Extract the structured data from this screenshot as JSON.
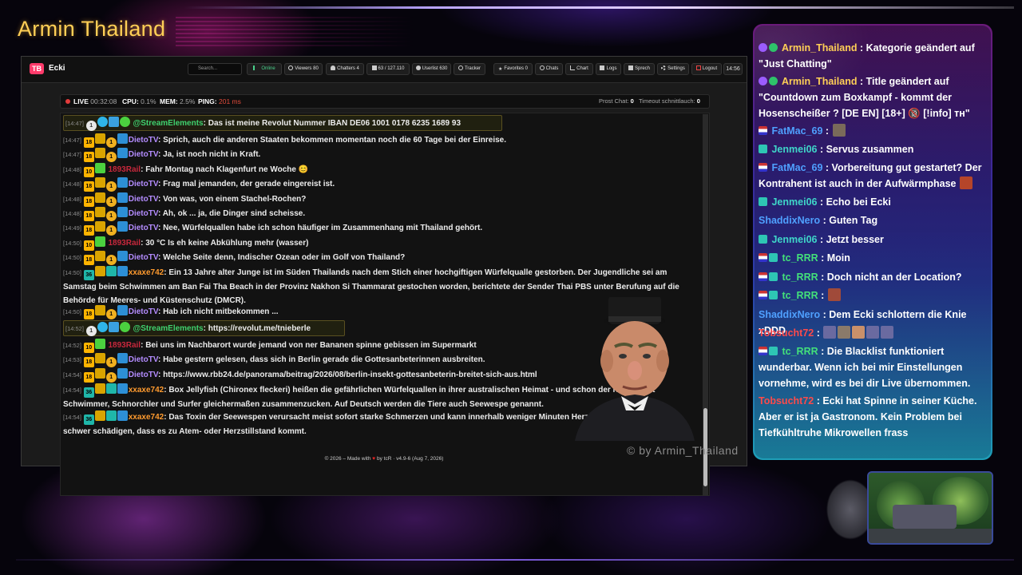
{
  "overlay": {
    "streamer_name": "Armin Thailand",
    "watermark": "© by Armin_Thailand"
  },
  "app": {
    "logo": "TB",
    "name": "Ecki",
    "search_placeholder": "Search...",
    "nav": {
      "online": "Online",
      "viewers": "Viewers 80",
      "chatters": "Chatters 4",
      "points": "63 / 127.110",
      "userlist": "Userlist 630",
      "tracker": "Tracker",
      "favorites": "Favorites 0",
      "chats": "Chats",
      "chart": "Chart",
      "logs": "Logs",
      "sprech": "Sprech",
      "settings": "Settings",
      "logout": "Logout",
      "clock": "14:56"
    },
    "status": {
      "live_label": "LIVE",
      "live_time": "00:32:08",
      "cpu_label": "CPU:",
      "cpu_value": "0.1%",
      "mem_label": "MEM:",
      "mem_value": "2.5%",
      "ping_label": "PING:",
      "ping_value": "201 ms",
      "prost_label": "Prost Chat:",
      "prost_value": "0",
      "timeout_label": "Timeout schnittlauch:",
      "timeout_value": "0"
    },
    "footer_pre": "© 2026 – Made with",
    "footer_post": "by tcR · v4.9-6 (Aug 7, 2026)"
  },
  "chat": [
    {
      "ts": "[14:47]",
      "user": "@StreamElements",
      "text": "Das ist meine Revolut Nummer IBAN DE06 1001 0178 6235 1689 93"
    },
    {
      "ts": "[14:47]",
      "user": "DietoTV",
      "text": "Sprich, auch die anderen Staaten bekommen momentan noch die 60 Tage bei der Einreise."
    },
    {
      "ts": "[14:47]",
      "user": "DietoTV",
      "text": "Ja, ist noch nicht in Kraft."
    },
    {
      "ts": "[14:48]",
      "user": "1893Rail",
      "text": "Fahr Montag nach Klagenfurt ne Woche 😊"
    },
    {
      "ts": "[14:48]",
      "user": "DietoTV",
      "text": "Frag mal jemanden, der gerade eingereist ist."
    },
    {
      "ts": "[14:48]",
      "user": "DietoTV",
      "text": "Von was, von einem Stachel-Rochen?"
    },
    {
      "ts": "[14:48]",
      "user": "DietoTV",
      "text": "Ah, ok ... ja, die Dinger sind scheisse."
    },
    {
      "ts": "[14:49]",
      "user": "DietoTV",
      "text": "Nee, Würfelquallen habe ich schon häufiger im Zusammenhang mit Thailand gehört."
    },
    {
      "ts": "[14:50]",
      "user": "1893Rail",
      "text": "30 °C Is eh keine Abkühlung mehr (wasser)"
    },
    {
      "ts": "[14:50]",
      "user": "DietoTV",
      "text": "Welche Seite denn, Indischer Ozean oder im Golf von Thailand?"
    },
    {
      "ts": "[14:50]",
      "user": "xxaxe742",
      "text": "Ein 13 Jahre alter Junge ist im Süden Thailands nach dem Stich einer hochgiftigen Würfelqualle gestorben. Der Jugendliche sei am Samstag beim Schwimmen am Ban Fai Tha Beach in der Provinz Nakhon Si Thammarat gestochen worden, berichtete der Sender Thai PBS unter Berufung auf die Behörde für Meeres- und Küstenschutz (DMCR)."
    },
    {
      "ts": "[14:50]",
      "user": "DietoTV",
      "text": "Hab ich nicht mitbekommen ..."
    },
    {
      "ts": "[14:52]",
      "user": "@StreamElements",
      "text": "https://revolut.me/tnieberle"
    },
    {
      "ts": "[14:52]",
      "user": "1893Rail",
      "text": "Bei uns im Nachbarort wurde jemand von ner Bananen spinne gebissen im Supermarkt"
    },
    {
      "ts": "[14:53]",
      "user": "DietoTV",
      "text": "Habe gestern gelesen, dass sich in Berlin gerade die Gottesanbeterinnen ausbreiten."
    },
    {
      "ts": "[14:54]",
      "user": "DietoTV",
      "text": "https://www.rbb24.de/panorama/beitrag/2026/08/berlin-insekt-gottesanbeterin-breitet-sich-aus.html"
    },
    {
      "ts": "[14:54]",
      "user": "xxaxe742",
      "text": "Box Jellyfish (Chironex fleckeri) heißen die gefährlichen Würfelquallen in ihrer australischen Heimat - und schon der Name lässt Schwimmer, Schnorchler und Surfer gleichermaßen zusammenzucken. Auf Deutsch werden die Tiere auch Seewespe genannt."
    },
    {
      "ts": "[14:54]",
      "user": "xxaxe742",
      "text": "Das Toxin der Seewespen verursacht meist sofort starke Schmerzen und kann innerhalb weniger Minuten Herz und Nervensystem so schwer schädigen, dass es zu Atem- oder Herzstillstand kommt."
    }
  ],
  "side_chat": [
    {
      "user": "Armin_Thailand",
      "text": "Kategorie geändert auf \"Just Chatting\""
    },
    {
      "user": "Armin_Thailand",
      "text": "Title geändert auf \"Countdown zum Boxkampf - kommt der Hosenscheißer ? [DE EN] [18+] 🔞 [!info] ᴛʜ\""
    },
    {
      "user": "FatMac_69",
      "text": ""
    },
    {
      "user": "Jenmei06",
      "text": "Servus zusammen"
    },
    {
      "user": "FatMac_69",
      "text": "Vorbereitung gut gestartet? Der Kontrahent ist auch in der Aufwärmphase"
    },
    {
      "user": "Jenmei06",
      "text": "Echo bei Ecki"
    },
    {
      "user": "ShaddixNero",
      "text": "Guten Tag"
    },
    {
      "user": "Jenmei06",
      "text": "Jetzt besser"
    },
    {
      "user": "tc_RRR",
      "text": "Moin"
    },
    {
      "user": "tc_RRR",
      "text": "Doch nicht an der Location?"
    },
    {
      "user": "tc_RRR",
      "text": ""
    },
    {
      "user": "ShaddixNero",
      "text": "Dem Ecki schlottern die Knie xDDD"
    },
    {
      "user": "Tobsucht72",
      "text": ""
    },
    {
      "user": "tc_RRR",
      "text": "Die Blacklist funktioniert wunderbar. Wenn ich bei mir Einstellungen vornehme, wird es bei dir Live übernommen."
    },
    {
      "user": "Tobsucht72",
      "text": "Ecki hat Spinne in seiner Küche. Aber er ist ja Gastronom. Kein Problem bei Tiefkühltruhe Mikrowellen frass"
    }
  ],
  "colors": {
    "accent_gold": "#ffcf56",
    "live_red": "#e23b3b",
    "online_green": "#49d18b"
  }
}
